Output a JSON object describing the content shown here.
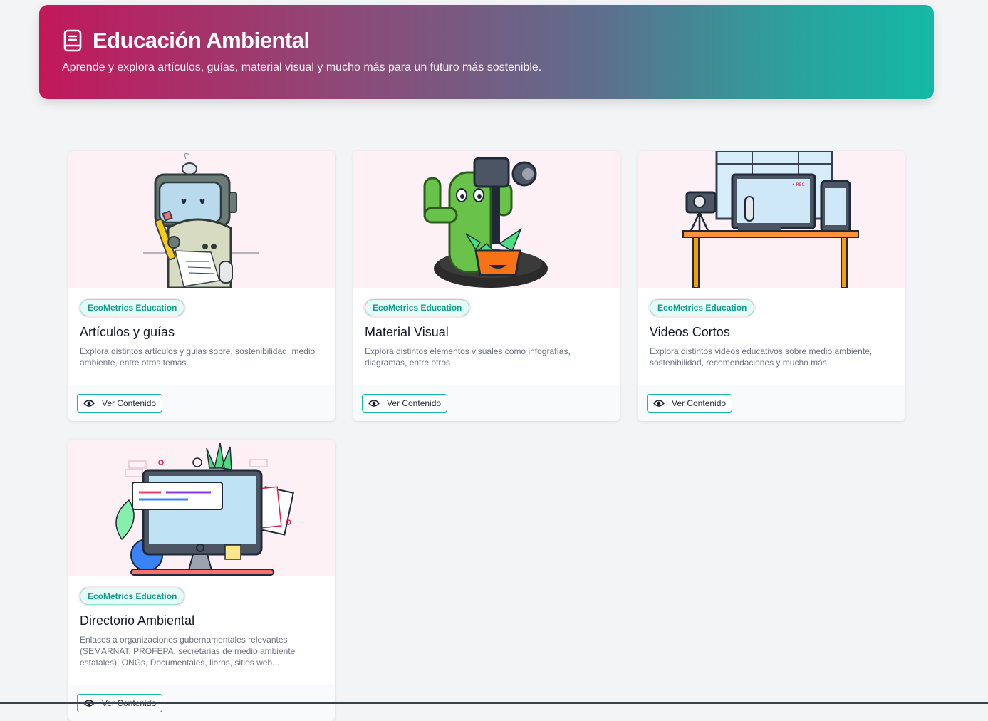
{
  "header": {
    "title": "Educación Ambiental",
    "subtitle": "Aprende y explora artículos, guías, material visual y mucho más para un futuro más sostenible.",
    "icon": "book-icon"
  },
  "cards": [
    {
      "badge": "EcoMetrics Education",
      "title": "Artículos y guías",
      "description": "Explora distintos artículos y guias sobre, sostenibilidad, medio ambiente, entre otros temas.",
      "button": "Ver Contenido",
      "illustration": "robot-writing-illustration"
    },
    {
      "badge": "EcoMetrics Education",
      "title": "Material Visual",
      "description": "Explora distintos elementos visuales como infografías, diagramas, entre otros",
      "button": "Ver Contenido",
      "illustration": "cactus-camera-illustration"
    },
    {
      "badge": "EcoMetrics Education",
      "title": "Videos Cortos",
      "description": "Explora distintos videos educativos sobre medio ambiente, sostenibilidad, recomendaciones y mucho más.",
      "button": "Ver Contenido",
      "illustration": "video-studio-illustration",
      "rec_label": "• REC"
    },
    {
      "badge": "EcoMetrics Education",
      "title": "Directorio Ambiental",
      "description": "Enlaces a organizaciones gubernamentales relevantes (SEMARNAT, PROFEPA, secretarias de medio ambiente estatales), ONGs, Documentales, libros, sitios web...",
      "button": "Ver Contenido",
      "illustration": "computer-desk-illustration"
    }
  ],
  "colors": {
    "gradient_start": "#c2185b",
    "gradient_end": "#14b8a6",
    "accent": "#14b8a6",
    "card_image_bg": "#fdf1f6"
  }
}
